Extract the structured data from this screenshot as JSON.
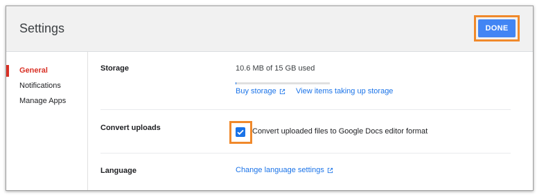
{
  "dialog": {
    "title": "Settings",
    "done_label": "DONE"
  },
  "sidebar": {
    "items": [
      {
        "label": "General",
        "active": true
      },
      {
        "label": "Notifications",
        "active": false
      },
      {
        "label": "Manage Apps",
        "active": false
      }
    ]
  },
  "storage": {
    "label": "Storage",
    "usage": "10.6 MB of 15 GB used",
    "used_fraction": 0.0007,
    "buy_link": "Buy storage",
    "view_link": "View items taking up storage"
  },
  "convert": {
    "label": "Convert uploads",
    "checkbox_label": "Convert uploaded files to Google Docs editor format",
    "checked": true
  },
  "language": {
    "label": "Language",
    "link": "Change language settings"
  },
  "colors": {
    "accent": "#1a73e8",
    "done_button": "#4285f4",
    "active_nav": "#d93025",
    "highlight": "#f0892b"
  },
  "icons": {
    "external_link": "open-in-new-icon",
    "check": "check-icon"
  }
}
